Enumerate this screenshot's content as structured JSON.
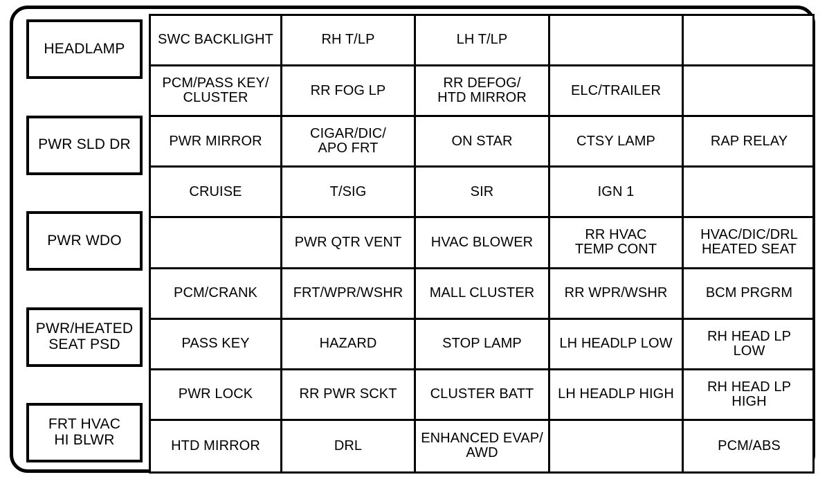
{
  "diagram": {
    "kind": "fuse-box-legend",
    "outline_shape": "rounded-rectangle",
    "border_color": "#000000",
    "background_color": "#ffffff"
  },
  "relay_column": {
    "items": [
      {
        "label": "HEADLAMP"
      },
      {
        "label": "PWR SLD DR"
      },
      {
        "label": "PWR WDO"
      },
      {
        "label": "PWR/HEATED\nSEAT PSD"
      },
      {
        "label": "FRT HVAC\nHI BLWR"
      }
    ]
  },
  "fuse_grid": {
    "columns": 5,
    "rows": 9,
    "cells": [
      [
        "SWC BACKLIGHT",
        "RH T/LP",
        "LH T/LP",
        "",
        ""
      ],
      [
        "PCM/PASS KEY/\nCLUSTER",
        "RR FOG LP",
        "RR DEFOG/\nHTD MIRROR",
        "ELC/TRAILER",
        ""
      ],
      [
        "PWR MIRROR",
        "CIGAR/DIC/\nAPO FRT",
        "ON STAR",
        "CTSY LAMP",
        "RAP RELAY"
      ],
      [
        "CRUISE",
        "T/SIG",
        "SIR",
        "IGN 1",
        ""
      ],
      [
        "",
        "PWR QTR VENT",
        "HVAC BLOWER",
        "RR HVAC\nTEMP CONT",
        "HVAC/DIC/DRL\nHEATED SEAT"
      ],
      [
        "PCM/CRANK",
        "FRT/WPR/WSHR",
        "MALL CLUSTER",
        "RR WPR/WSHR",
        "BCM PRGRM"
      ],
      [
        "PASS KEY",
        "HAZARD",
        "STOP LAMP",
        "LH HEADLP LOW",
        "RH HEAD LP\nLOW"
      ],
      [
        "PWR LOCK",
        "RR PWR SCKT",
        "CLUSTER BATT",
        "LH HEADLP HIGH",
        "RH HEAD LP\nHIGH"
      ],
      [
        "HTD MIRROR",
        "DRL",
        "ENHANCED EVAP/\nAWD",
        "",
        "PCM/ABS"
      ]
    ]
  }
}
